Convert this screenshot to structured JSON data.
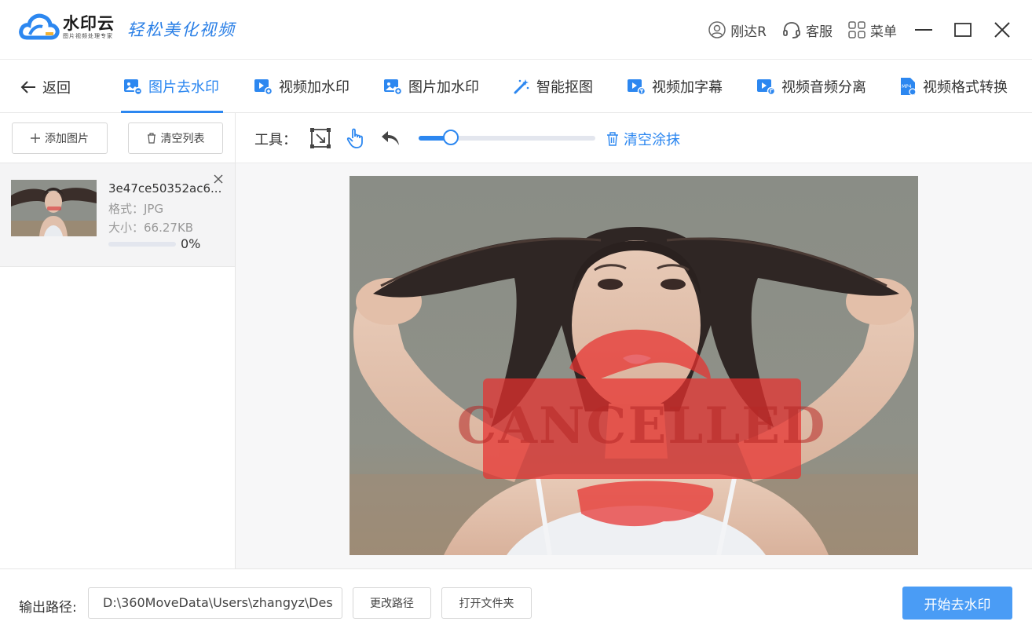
{
  "app": {
    "name": "水印云",
    "sub": "图片视频处理专家",
    "slogan": "轻松美化视频"
  },
  "header": {
    "user": "刚达R",
    "service": "客服",
    "menu": "菜单"
  },
  "nav": {
    "back": "返回",
    "tabs": [
      {
        "label": "图片去水印",
        "active": true
      },
      {
        "label": "视频加水印"
      },
      {
        "label": "图片加水印"
      },
      {
        "label": "智能抠图"
      },
      {
        "label": "视频加字幕"
      },
      {
        "label": "视频音频分离"
      },
      {
        "label": "视频格式转换"
      }
    ]
  },
  "list": {
    "add_label": "添加图片",
    "clear_label": "清空列表",
    "items": [
      {
        "name": "3e47ce50352ac6...",
        "format": "格式：JPG",
        "size": "大小：66.27KB",
        "progress": "0%"
      }
    ]
  },
  "tools": {
    "label": "工具：",
    "brush_level": 0.18,
    "clear_paint": "清空涂抹"
  },
  "preview": {
    "watermark_text": "CANCELLED"
  },
  "output": {
    "label": "输出路径:",
    "path": "D:\\360MoveData\\Users\\zhangyz\\Des",
    "change_label": "更改路径",
    "open_label": "打开文件夹",
    "start_label": "开始去水印"
  },
  "colors": {
    "accent": "#2c87f0",
    "start_button": "#4a9cf5",
    "watermark": "#e8312f"
  }
}
